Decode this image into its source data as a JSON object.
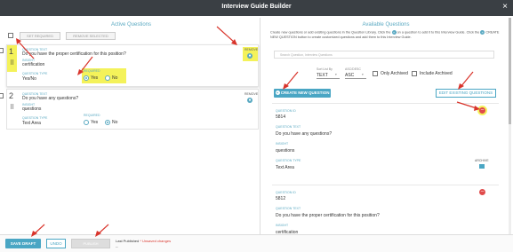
{
  "window": {
    "title": "Interview Guide Builder",
    "close": "×"
  },
  "left": {
    "title": "Active Questions",
    "set_required": "SET REQUIRED",
    "remove_selected": "REMOVE SELECTED",
    "questions": [
      {
        "number": "1",
        "text_label": "QUESTION TEXT",
        "text": "Do you have the proper certification for this position?",
        "insight_label": "INSIGHT",
        "insight": "certification",
        "type_label": "QUESTION TYPE",
        "type": "Yes/No",
        "required_label": "REQUIRED",
        "yes": "Yes",
        "no": "No",
        "required_value": "Yes",
        "remove_label": "REMOVE"
      },
      {
        "number": "2",
        "text_label": "QUESTION TEXT",
        "text": "Do you have any questions?",
        "insight_label": "INSIGHT",
        "insight": "questions",
        "type_label": "QUESTION TYPE",
        "type": "Text Area",
        "required_label": "REQUIRED",
        "yes": "Yes",
        "no": "No",
        "required_value": "No",
        "remove_label": "REMOVE"
      }
    ]
  },
  "right": {
    "title": "Available Questions",
    "description_1": "Create new questions or add existing questions in the Question Library. Click the",
    "description_2": "on a question to add it to this Interview Guide. Click the",
    "description_3": "CREATE NEW QUESTION button to create customized questions and add them to this Interview Guide.",
    "search_placeholder": "Search Question, Interview Questions",
    "sort_by_label": "Sort List By",
    "sort_by_value": "TEXT",
    "asc_label": "ASC/DESC",
    "asc_value": "ASC",
    "only_archived": "Only Archived",
    "include_archived": "Include Archived",
    "create_new": "CREATE NEW QUESTION",
    "edit_existing": "EDIT EXISTING QUESTIONS",
    "cards": [
      {
        "id_label": "QUESTION ID",
        "id": "5814",
        "text_label": "QUESTION TEXT",
        "text": "Do you have any questions?",
        "insight_label": "INSIGHT",
        "insight": "questions",
        "type_label": "QUESTION TYPE",
        "type": "Text Area",
        "archive_label": "ARCHIVE"
      },
      {
        "id_label": "QUESTION ID",
        "id": "5812",
        "text_label": "QUESTION TEXT",
        "text": "Do you have the proper certification for this position?",
        "insight_label": "INSIGHT",
        "insight": "certification"
      }
    ]
  },
  "footer": {
    "save_draft": "SAVE DRAFT",
    "undo": "UNDO",
    "publish": "PUBLISH",
    "last_published_label": "Last Published",
    "unsaved": "* Unsaved changes",
    "last_published_value": "--"
  },
  "colors": {
    "accent": "#4aa6c4",
    "highlight": "#f4f25a",
    "remove": "#e04b4b",
    "arrow": "#d9342b"
  }
}
